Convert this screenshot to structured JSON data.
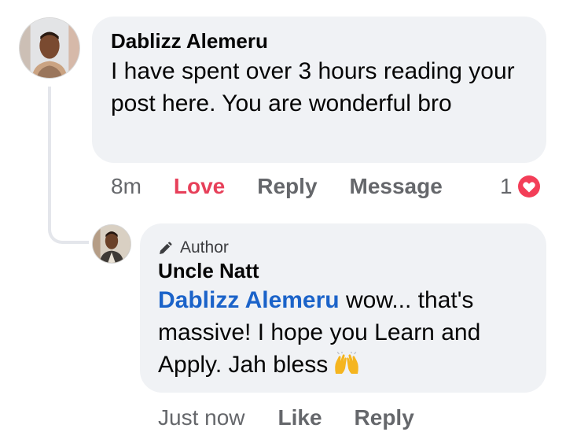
{
  "thread": {
    "comment": {
      "author": "Dablizz Alemeru",
      "text": "I have spent over 3 hours reading your post here. You are wonderful bro",
      "avatar_icon": "user-photo-avatar",
      "actions": {
        "time": "8m",
        "love": "Love",
        "reply": "Reply",
        "message": "Message"
      },
      "reaction_count": "1",
      "reaction_icon": "heart-icon",
      "reaction_color": "#f33e58"
    },
    "reply": {
      "badge": "Author",
      "badge_icon": "pencil-icon",
      "author": "Uncle Natt",
      "mention": "Dablizz Alemeru",
      "text": "wow... that's massive! I hope you Learn and Apply. Jah bless",
      "emoji_icon": "raising-hands-emoji",
      "avatar_icon": "user-photo-avatar",
      "actions": {
        "time": "Just now",
        "like": "Like",
        "reply": "Reply"
      }
    }
  },
  "colors": {
    "bubble": "#f0f2f5",
    "mention": "#1b63c9",
    "love": "#e7405a",
    "muted": "#65676b"
  }
}
